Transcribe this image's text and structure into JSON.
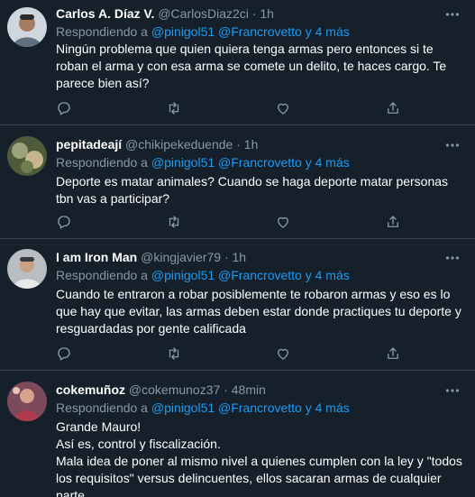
{
  "reply_prefix": "Respondiendo a",
  "tweets": [
    {
      "name": "Carlos A. Díaz V.",
      "handle": "@CarlosDiaz2ci",
      "dot": "·",
      "time": "1h",
      "mention1": "@pinigol51",
      "mention2": "@Francrovetto y 4 más",
      "lines": [
        "Ningún problema que quien quiera tenga armas pero entonces si te roban el arma y con esa arma se comete un delito, te haces cargo. Te parece bien así?"
      ]
    },
    {
      "name": "pepitadeají",
      "handle": "@chikipekeduende",
      "dot": "·",
      "time": "1h",
      "mention1": "@pinigol51",
      "mention2": "@Francrovetto y 4 más",
      "lines": [
        "Deporte es matar animales? Cuando se haga deporte matar personas tbn vas a participar?"
      ]
    },
    {
      "name": "I am Iron Man",
      "handle": "@kingjavier79",
      "dot": "·",
      "time": "1h",
      "mention1": "@pinigol51",
      "mention2": "@Francrovetto y 4 más",
      "lines": [
        "Cuando te entraron a robar posiblemente te robaron armas y eso es lo que hay que evitar, las armas deben estar donde practiques tu deporte y resguardadas por gente calificada"
      ]
    },
    {
      "name": "cokemuñoz",
      "handle": "@cokemunoz37",
      "dot": "·",
      "time": "48min",
      "mention1": "@pinigol51",
      "mention2": "@Francrovetto y 4 más",
      "lines": [
        "Grande Mauro!",
        "Así es, control y fiscalización.",
        "Mala idea de poner al mismo nivel a quienes cumplen con la ley y \"todos los requisitos\" versus delincuentes, ellos sacaran armas de cualquier parte."
      ]
    }
  ],
  "icons": {
    "more": "more-icon",
    "reply": "reply-icon",
    "retweet": "retweet-icon",
    "like": "heart-icon",
    "share": "share-icon"
  }
}
